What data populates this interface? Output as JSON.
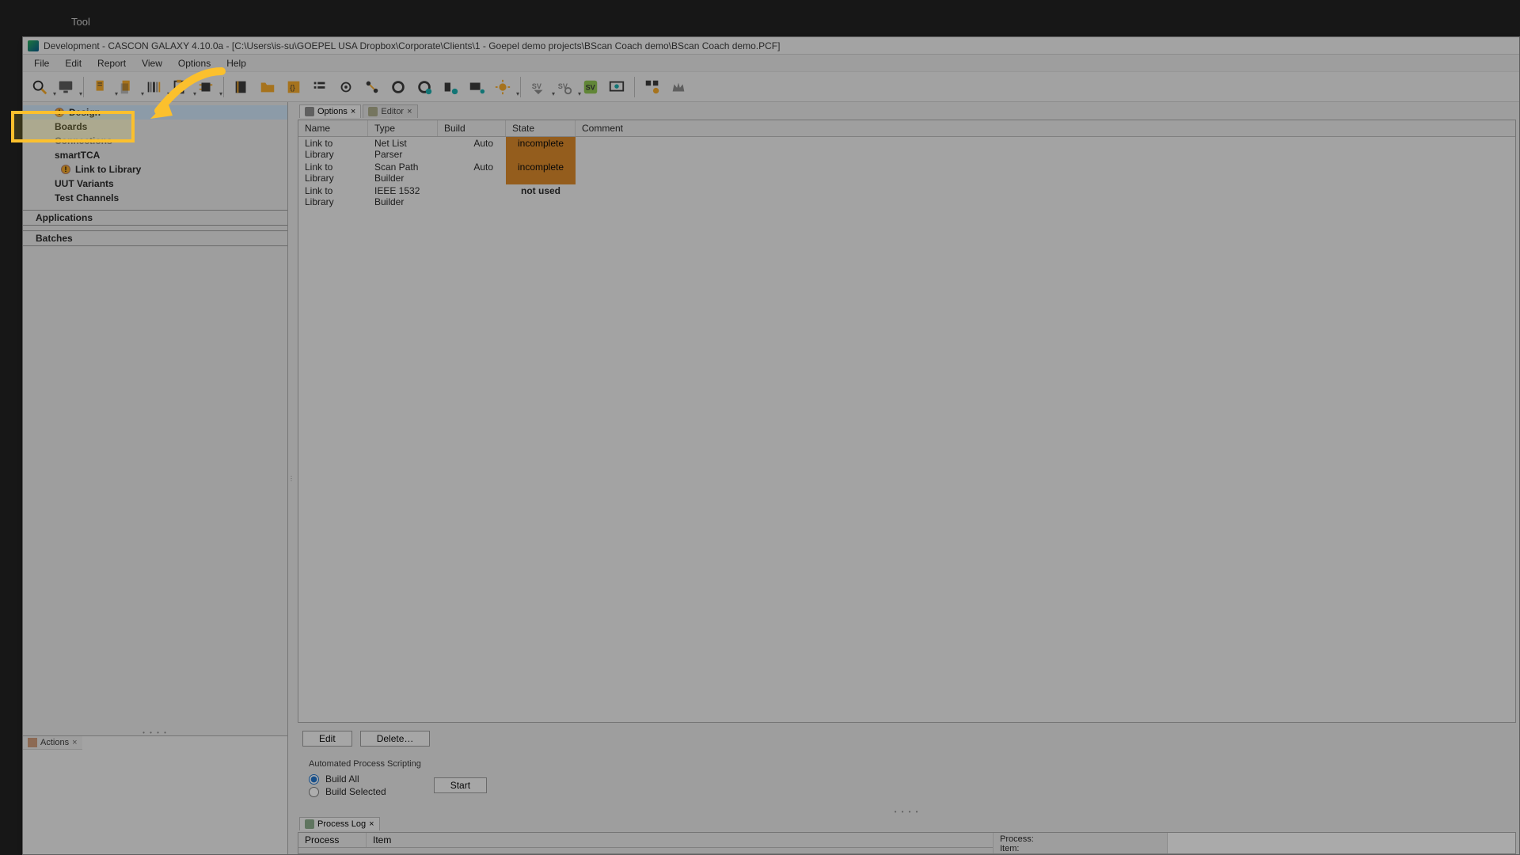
{
  "top_tool_label": "Tool",
  "window_title": "Development - CASCON GALAXY 4.10.0a - [C:\\Users\\is-su\\GOEPEL USA Dropbox\\Corporate\\Clients\\1 - Goepel demo projects\\BScan Coach demo\\BScan Coach demo.PCF]",
  "menu": {
    "file": "File",
    "edit": "Edit",
    "report": "Report",
    "view": "View",
    "options": "Options",
    "help": "Help"
  },
  "tree": {
    "design": "Design",
    "boards": "Boards",
    "connections": "Connections",
    "smarttca": "smartTCA",
    "link_to_library": "Link to Library",
    "uut_variants": "UUT Variants",
    "test_channels": "Test Channels",
    "applications": "Applications",
    "batches": "Batches"
  },
  "tabs": {
    "options": "Options",
    "editor": "Editor"
  },
  "columns": {
    "name": "Name",
    "type": "Type",
    "build": "Build",
    "state": "State",
    "comment": "Comment"
  },
  "rows": [
    {
      "name": "Link to Library",
      "type": "Net List Parser",
      "build": "Auto",
      "state": "incomplete",
      "state_class": "bad"
    },
    {
      "name": "Link to Library",
      "type": "Scan Path Builder",
      "build": "Auto",
      "state": "incomplete",
      "state_class": "bad"
    },
    {
      "name": "Link to Library",
      "type": "IEEE 1532 Builder",
      "build": "",
      "state": "not used",
      "state_class": "neutral"
    }
  ],
  "buttons": {
    "edit": "Edit",
    "delete": "Delete…",
    "start": "Start"
  },
  "scripting": {
    "title": "Automated Process Scripting",
    "build_all": "Build All",
    "build_selected": "Build Selected"
  },
  "actions_tab": "Actions",
  "process_log": {
    "tab": "Process Log",
    "col_process": "Process",
    "col_item": "Item",
    "status_process": "Process:",
    "status_item": "Item:"
  }
}
